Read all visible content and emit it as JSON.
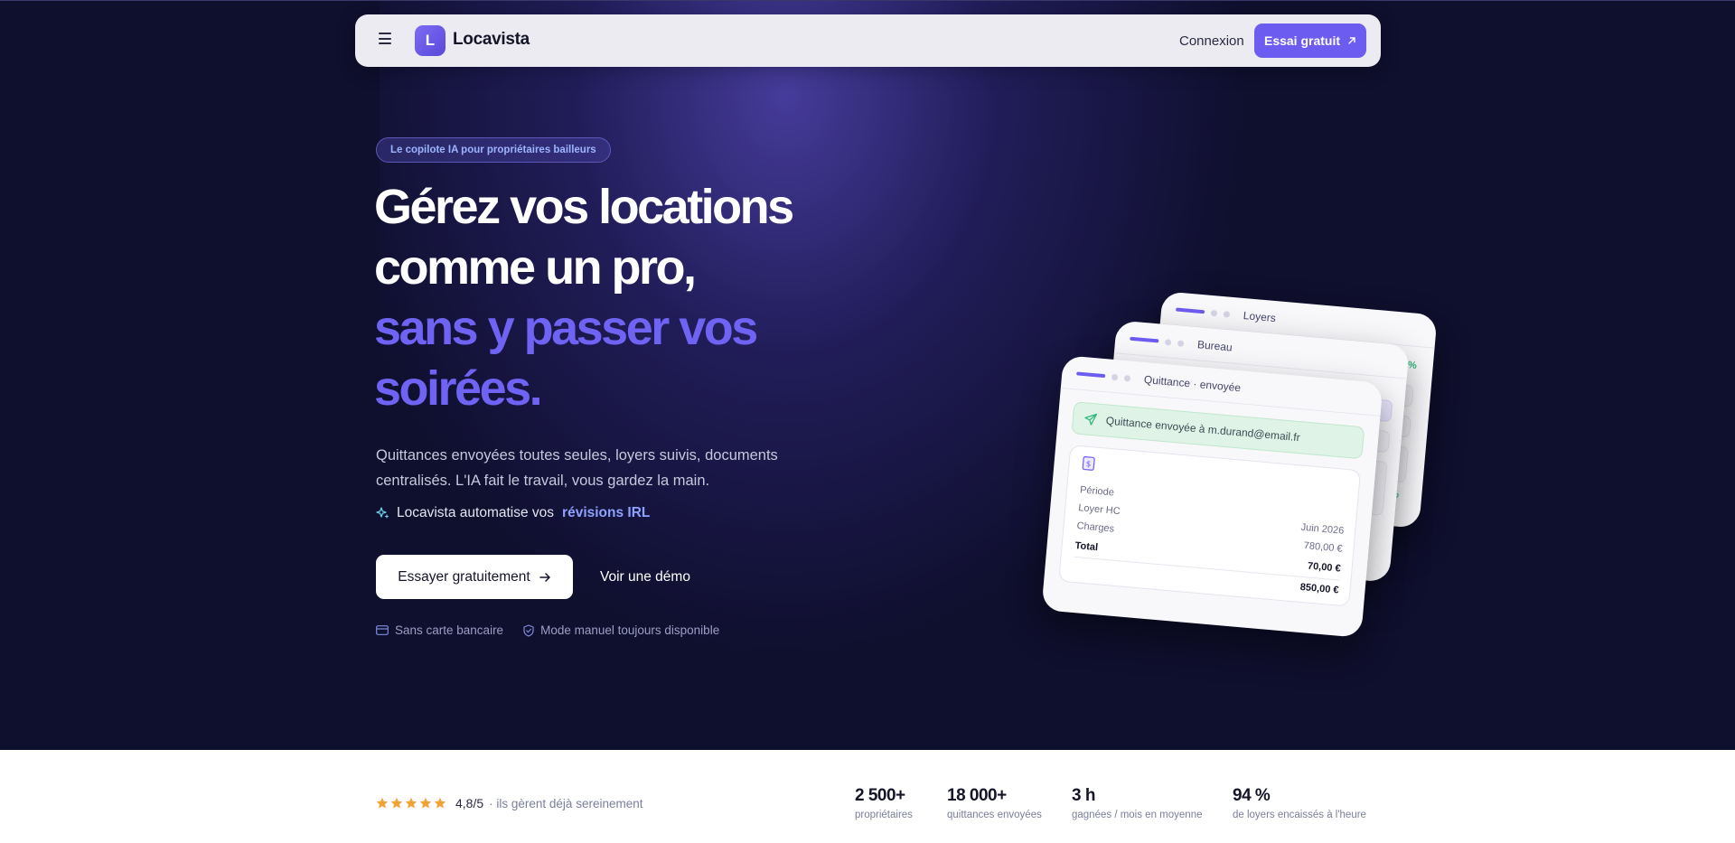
{
  "navbar": {
    "logo_letter": "L",
    "brand": "Locavista",
    "login": "Connexion",
    "cta": "Essai gratuit",
    "menu_icon": "hamburger-menu-icon",
    "cta_icon": "arrow-up-right-icon"
  },
  "hero": {
    "badge": "Le copilote IA pour propriétaires bailleurs",
    "headline_line1": "Gérez vos locations",
    "headline_line2": "comme un pro,",
    "headline_line3": "sans y passer vos",
    "headline_line4": "soirées.",
    "subtitle": "Quittances envoyées toutes seules, loyers suivis, documents centralisés. L'IA fait le travail, vous gardez la main.",
    "ai_prefix": "Locavista automatise vos",
    "ai_highlight": "révisions IRL",
    "primary_button": "Essayer gratuitement",
    "secondary_button": "Voir une démo",
    "reassurance": [
      {
        "icon": "credit-card-icon",
        "label": "Sans carte bancaire"
      },
      {
        "icon": "shield-check-icon",
        "label": "Mode manuel toujours disponible"
      }
    ]
  },
  "cards": {
    "back_title": "Loyers",
    "back_value_a": "1 %",
    "back_value_b": "%",
    "middle_title": "Bureau",
    "front_title": "Quittance · envoyée",
    "sent_message": "Quittance envoyée à m.durand@email.fr",
    "rows": [
      {
        "label": "Période",
        "value": ""
      },
      {
        "label": "Loyer HC",
        "value": "Juin 2026"
      },
      {
        "label": "Charges",
        "value": "780,00 €"
      },
      {
        "label": "Total",
        "value": "70,00 €"
      },
      {
        "label": "",
        "value": "850,00 €"
      }
    ]
  },
  "stats_bar": {
    "rating": "4,8/5",
    "rating_note": "· ils gèrent déjà sereinement",
    "stars": 5,
    "items": [
      {
        "value": "2 500+",
        "label": "propriétaires"
      },
      {
        "value": "18 000+",
        "label": "quittances envoyées"
      },
      {
        "value": "3 h",
        "label": "gagnées / mois en moyenne"
      },
      {
        "value": "94 %",
        "label": "de loyers encaissés à l'heure"
      }
    ]
  },
  "colors": {
    "hero_bg": "#0f0f2e",
    "accent": "#6d5cf0",
    "headline_accent": "#6e63f2",
    "link_accent": "#8ea2ff",
    "star": "#f2a33a",
    "success": "#30b97b"
  }
}
